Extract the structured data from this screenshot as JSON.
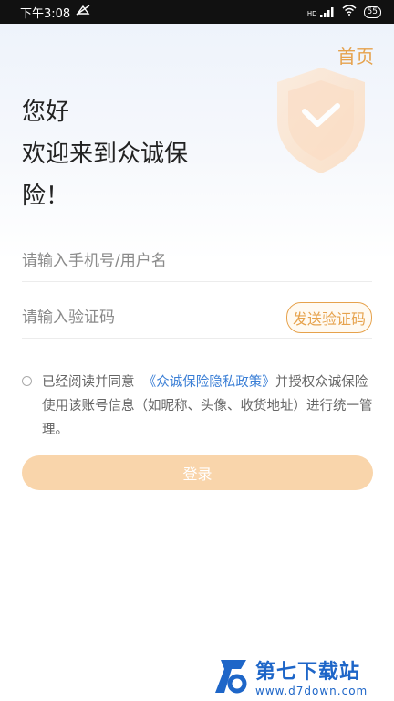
{
  "status_bar": {
    "time": "下午3:08",
    "network": "HD",
    "battery": "55"
  },
  "header": {
    "home_label": "首页"
  },
  "greeting": {
    "line1": "您好",
    "line2": "欢迎来到众诚保",
    "line3": "险！"
  },
  "form": {
    "phone_placeholder": "请输入手机号/用户名",
    "code_placeholder": "请输入验证码",
    "send_code_label": "发送验证码"
  },
  "agreement": {
    "prefix": "已经阅读并同意",
    "policy_link": "《众诚保险隐私政策》",
    "suffix": "并授权众诚保险使用该账号信息（如昵称、头像、收货地址）进行统一管理。"
  },
  "login_label": "登录",
  "watermark": {
    "title": "第七下载站",
    "url": "www.d7down.com"
  },
  "colors": {
    "accent": "#e6a24c",
    "link": "#3b7fd6",
    "button_bg": "#f9d5ab"
  }
}
